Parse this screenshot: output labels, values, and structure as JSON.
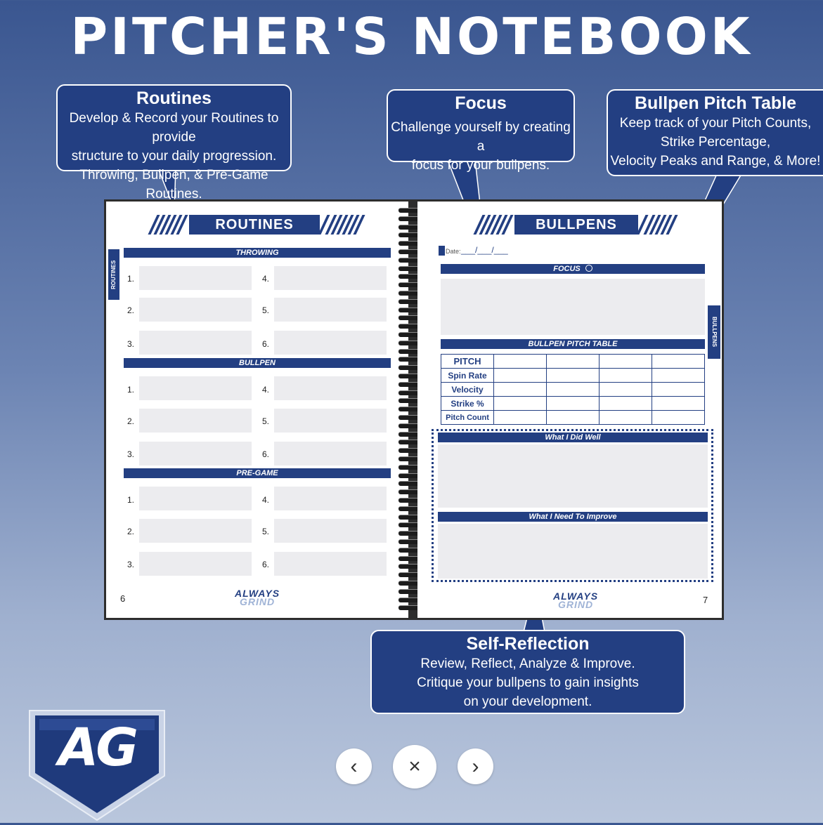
{
  "title": "PITCHER'S NOTEBOOK",
  "callouts": {
    "routines": {
      "heading": "Routines",
      "lines": [
        "Develop & Record your Routines to provide",
        "structure to your daily progression.",
        "Throwing, Bullpen, & Pre-Game Routines."
      ]
    },
    "focus": {
      "heading": "Focus",
      "lines": [
        "Challenge yourself by creating a",
        "focus for your bullpens."
      ]
    },
    "bullpen_table": {
      "heading": "Bullpen Pitch Table",
      "lines": [
        "Keep track of your Pitch Counts,",
        "Strike Percentage,",
        "Velocity Peaks and Range, & More!"
      ]
    },
    "self_reflection": {
      "heading": "Self-Reflection",
      "lines": [
        "Review, Reflect, Analyze & Improve.",
        "Critique your bullpens to gain insights",
        "on your development."
      ]
    }
  },
  "left_page": {
    "header": "ROUTINES",
    "side_tab": "ROUTINES",
    "sections": [
      "THROWING",
      "BULLPEN",
      "PRE-GAME"
    ],
    "numbers_left": [
      "1.",
      "2.",
      "3."
    ],
    "numbers_right": [
      "4.",
      "5.",
      "6."
    ],
    "page_number": "6",
    "brand_top": "ALWAYS",
    "brand_bottom": "GRIND"
  },
  "right_page": {
    "header": "BULLPENS",
    "side_tab": "BULLPENS",
    "date_label": "Date:",
    "date_blank": "___/___/___",
    "focus_label": "FOCUS",
    "table_label": "BULLPEN PITCH TABLE",
    "table_rows": [
      "PITCH",
      "Spin Rate",
      "Velocity",
      "Strike %",
      "Pitch Count"
    ],
    "did_well_label": "What I Did Well",
    "improve_label": "What I Need To Improve",
    "page_number": "7",
    "brand_top": "ALWAYS",
    "brand_bottom": "GRIND"
  },
  "nav": {
    "prev_icon": "‹",
    "close_icon": "×",
    "next_icon": "›"
  },
  "logo_text": "AG",
  "colors": {
    "navy": "#233f82",
    "box_gray": "#ececef"
  }
}
